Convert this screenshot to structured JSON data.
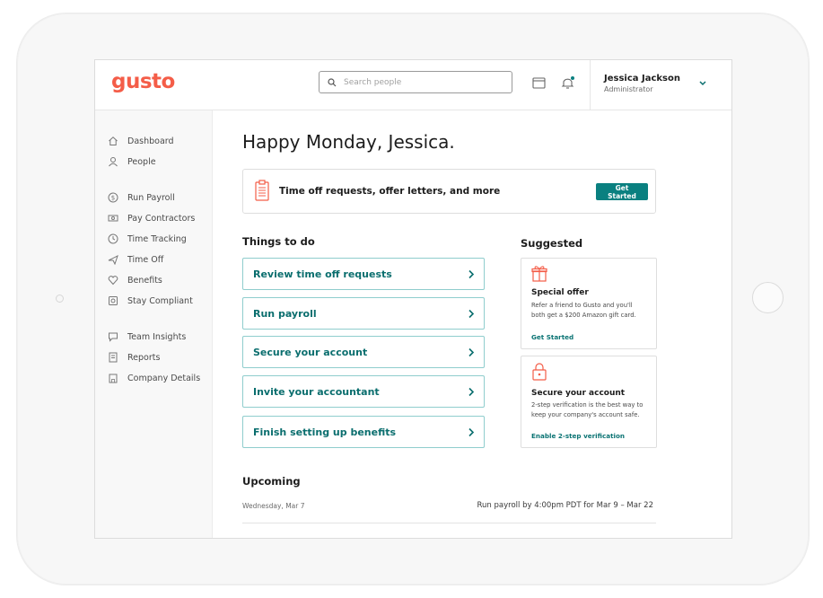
{
  "app": {
    "logo": "gusto",
    "accent": "#f45d48",
    "teal": "#0a8080"
  },
  "header": {
    "search_placeholder": "Search people",
    "icons": [
      "search-icon",
      "calendar-icon",
      "bell-icon",
      "chevron-down-icon"
    ],
    "user": {
      "name": "Jessica Jackson",
      "role": "Administrator"
    }
  },
  "sidebar": {
    "items": [
      {
        "label": "Dashboard",
        "icon": "home-icon"
      },
      {
        "label": "People",
        "icon": "person-icon"
      },
      {
        "label": "Run Payroll",
        "icon": "dollar-icon"
      },
      {
        "label": "Pay Contractors",
        "icon": "money-icon"
      },
      {
        "label": "Time Tracking",
        "icon": "clock-icon"
      },
      {
        "label": "Time Off",
        "icon": "plane-icon"
      },
      {
        "label": "Benefits",
        "icon": "heart-icon"
      },
      {
        "label": "Stay Compliant",
        "icon": "safe-icon"
      },
      {
        "label": "Team Insights",
        "icon": "chat-icon"
      },
      {
        "label": "Reports",
        "icon": "report-icon"
      },
      {
        "label": "Company Details",
        "icon": "building-icon"
      }
    ]
  },
  "main": {
    "greeting": "Happy Monday, Jessica.",
    "banner": {
      "text": "Time off requests, offer letters, and more",
      "button": "Get Started"
    },
    "todo": {
      "title": "Things to do",
      "items": [
        "Review time off requests",
        "Run payroll",
        "Secure your account",
        "Invite your accountant",
        "Finish setting up benefits"
      ]
    },
    "suggested": {
      "title": "Suggested",
      "cards": [
        {
          "icon": "gift-icon",
          "title": "Special offer",
          "body_lines": [
            "Refer a friend to Gusto and you'll",
            "both get a $200 Amazon gift card."
          ],
          "link": "Get Started"
        },
        {
          "icon": "lock-icon",
          "title": "Secure your account",
          "body_lines": [
            "2-step verification is the best way to",
            "keep your company's account safe."
          ],
          "link": "Enable 2-step verification"
        }
      ]
    },
    "upcoming": {
      "title": "Upcoming",
      "date": "Wednesday, Mar 7",
      "text": "Run payroll by 4:00pm PDT for Mar 9 – Mar 22"
    }
  }
}
